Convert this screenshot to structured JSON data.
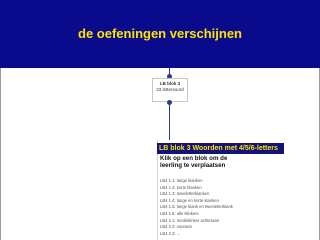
{
  "banner": {
    "title": "de oefeningen verschijnen"
  },
  "node": {
    "title": "LB blok 3",
    "subtitle": "23 lettersoord"
  },
  "panel": {
    "header": "LB blok 3 Woorden met 4/5/6-letters",
    "description": "Klik op een blok om de leerling te verplaatsen",
    "items": [
      "LB4 1.1: lange klanken",
      "LB4 1.2: korte klanken",
      "LB4 1.3: tweeletterklanken",
      "LB4 1.4: lange en korte klanken",
      "LB4 1.5: lange klank en tweeletterklank",
      "LB4 1.6: alle klinkers",
      "LB4 2.1: medeklinker achteraan",
      "LB4 2.2: vooraan",
      "LB4 2.3: ..."
    ]
  },
  "colors": {
    "banner_bg": "#0a0a8c",
    "banner_text": "#ffe400",
    "panel_header_bg": "#12127a",
    "connector": "#2e3a8c"
  }
}
